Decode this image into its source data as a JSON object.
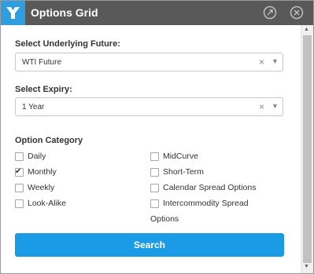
{
  "window": {
    "title": "Options Grid",
    "icons": {
      "logo": "app-logo-icon",
      "popout": "popout-icon",
      "close": "close-icon"
    }
  },
  "underlying": {
    "label": "Select Underlying Future:",
    "value": "WTI Future",
    "clear": "×",
    "caret": "▼"
  },
  "expiry": {
    "label": "Select Expiry:",
    "value": "1 Year",
    "clear": "×",
    "caret": "▼"
  },
  "option_category": {
    "label": "Option Category",
    "left": [
      {
        "label": "Daily",
        "checked": false
      },
      {
        "label": "Monthly",
        "checked": true
      },
      {
        "label": "Weekly",
        "checked": false
      },
      {
        "label": "Look-Alike",
        "checked": false
      }
    ],
    "right": [
      {
        "label": "MidCurve",
        "checked": false
      },
      {
        "label": "Short-Term",
        "checked": false
      },
      {
        "label": "Calendar Spread Options",
        "checked": false
      },
      {
        "label": "Intercommodity Spread",
        "label2": "Options",
        "checked": false
      }
    ]
  },
  "search_button": "Search",
  "scrollbar": {
    "up": "▲",
    "down": "▼"
  },
  "colors": {
    "titlebar": "#595959",
    "logo_bg": "#2f9ee0",
    "button": "#1b9ae6"
  }
}
